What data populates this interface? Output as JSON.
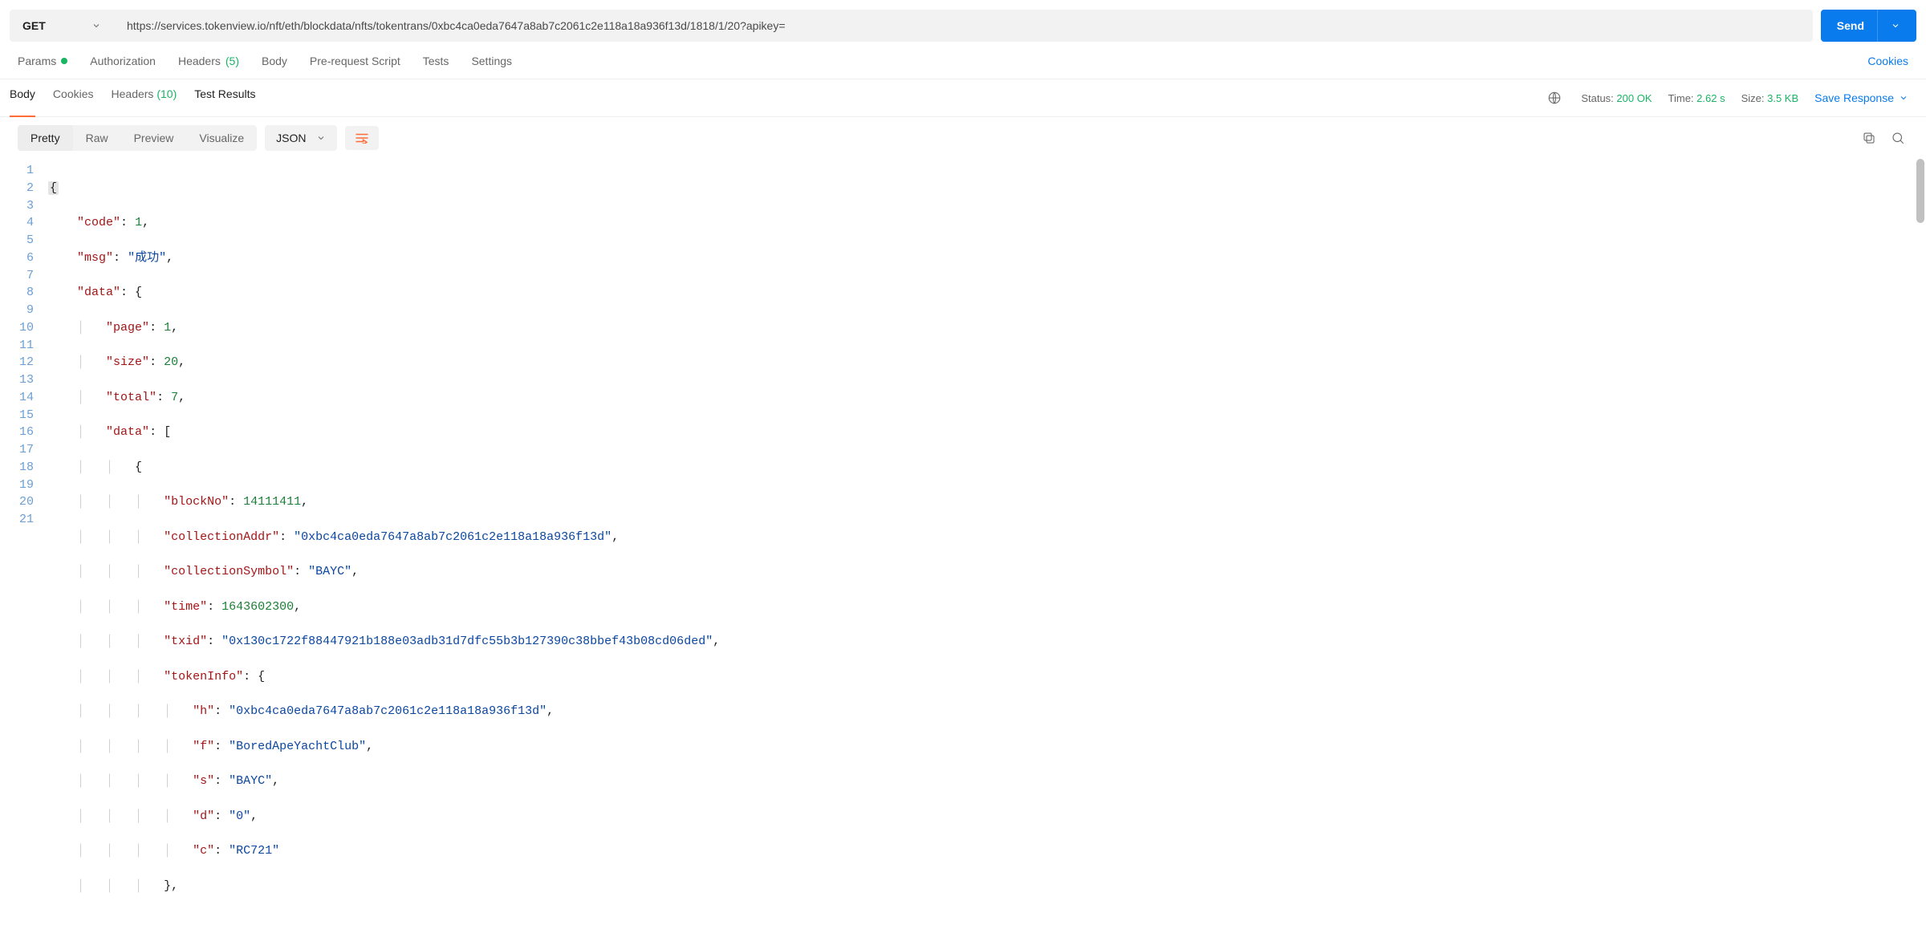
{
  "request": {
    "method": "GET",
    "url": "https://services.tokenview.io/nft/eth/blockdata/nfts/tokentrans/0xbc4ca0eda7647a8ab7c2061c2e118a18a936f13d/1818/1/20?apikey=",
    "send_label": "Send"
  },
  "request_tabs": {
    "params": "Params",
    "authorization": "Authorization",
    "headers": "Headers",
    "headers_count": "(5)",
    "body": "Body",
    "prerequest": "Pre-request Script",
    "tests": "Tests",
    "settings": "Settings",
    "cookies": "Cookies"
  },
  "response_tabs": {
    "body": "Body",
    "cookies": "Cookies",
    "headers": "Headers",
    "headers_count": "(10)",
    "test_results": "Test Results"
  },
  "status": {
    "status_label": "Status:",
    "status_value": "200 OK",
    "time_label": "Time:",
    "time_value": "2.62 s",
    "size_label": "Size:",
    "size_value": "3.5 KB",
    "save_response": "Save Response"
  },
  "view": {
    "pretty": "Pretty",
    "raw": "Raw",
    "preview": "Preview",
    "visualize": "Visualize",
    "format": "JSON"
  },
  "code_lines": {
    "l1": "{",
    "l2_k": "\"code\"",
    "l2_v": "1",
    "l3_k": "\"msg\"",
    "l3_v": "\"成功\"",
    "l4_k": "\"data\"",
    "l5_k": "\"page\"",
    "l5_v": "1",
    "l6_k": "\"size\"",
    "l6_v": "20",
    "l7_k": "\"total\"",
    "l7_v": "7",
    "l8_k": "\"data\"",
    "l10_k": "\"blockNo\"",
    "l10_v": "14111411",
    "l11_k": "\"collectionAddr\"",
    "l11_v": "\"0xbc4ca0eda7647a8ab7c2061c2e118a18a936f13d\"",
    "l12_k": "\"collectionSymbol\"",
    "l12_v": "\"BAYC\"",
    "l13_k": "\"time\"",
    "l13_v": "1643602300",
    "l14_k": "\"txid\"",
    "l14_v": "\"0x130c1722f88447921b188e03adb31d7dfc55b3b127390c38bbef43b08cd06ded\"",
    "l15_k": "\"tokenInfo\"",
    "l16_k": "\"h\"",
    "l16_v": "\"0xbc4ca0eda7647a8ab7c2061c2e118a18a936f13d\"",
    "l17_k": "\"f\"",
    "l17_v": "\"BoredApeYachtClub\"",
    "l18_k": "\"s\"",
    "l18_v": "\"BAYC\"",
    "l19_k": "\"d\"",
    "l19_v": "\"0\"",
    "l20_k": "\"c\"",
    "l20_v": "\"RC721\""
  },
  "line_numbers": [
    "1",
    "2",
    "3",
    "4",
    "5",
    "6",
    "7",
    "8",
    "9",
    "10",
    "11",
    "12",
    "13",
    "14",
    "15",
    "16",
    "17",
    "18",
    "19",
    "20",
    "21"
  ]
}
